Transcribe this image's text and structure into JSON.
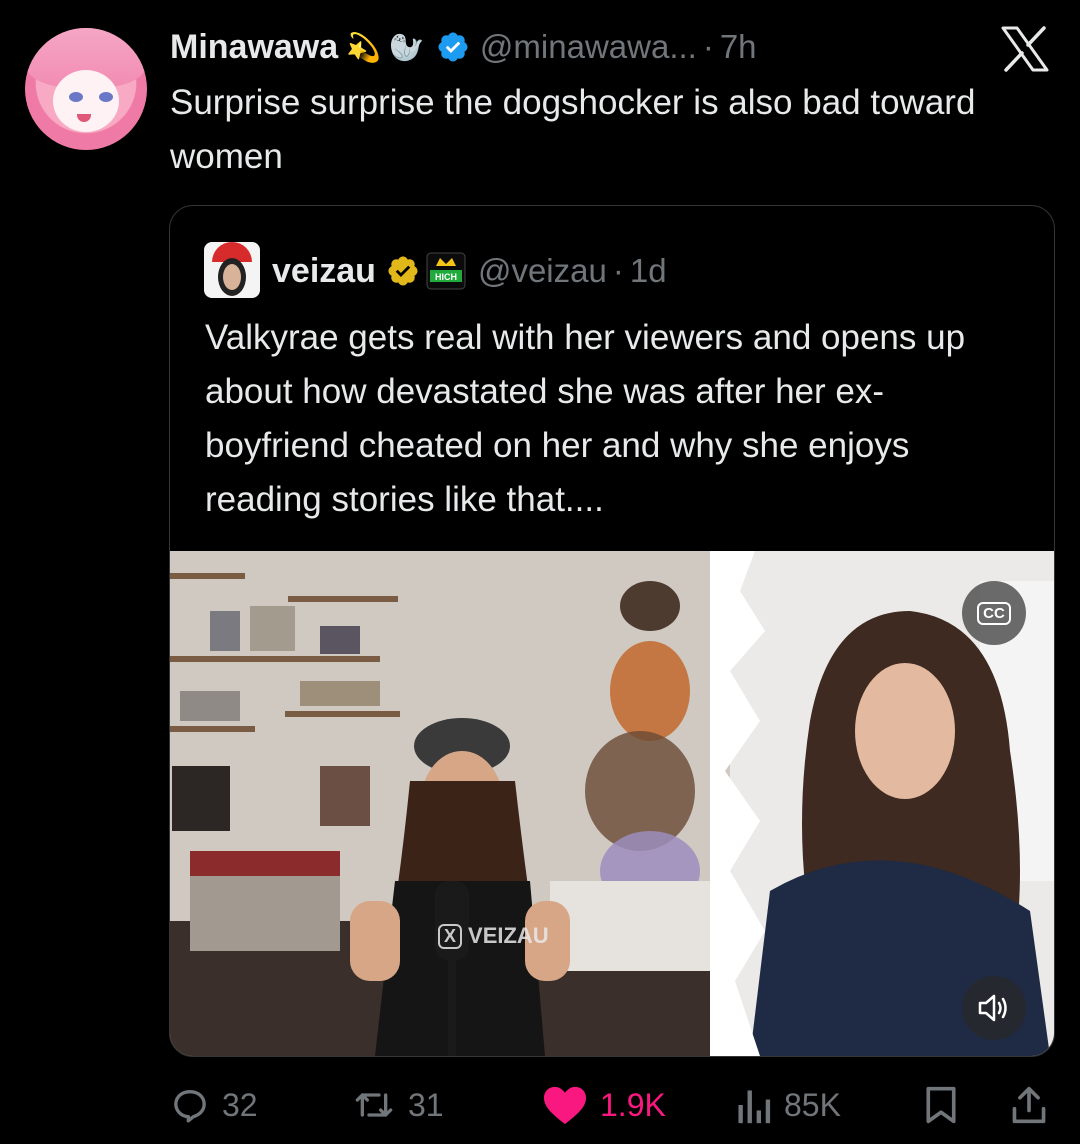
{
  "tweet": {
    "author_name": "Minawawa",
    "author_handle": "@minawawa...",
    "time": "7h",
    "separator": "·",
    "text": "Surprise surprise the dogshocker is also bad toward women",
    "name_emojis": [
      "dizzy-star",
      "seal"
    ]
  },
  "quoted": {
    "author_name": "veizau",
    "author_handle": "@veizau",
    "time": "1d",
    "separator": "·",
    "text": "Valkyrae gets real with her viewers and opens up about how devastated she was after her ex-boyfriend cheated on her and why she enjoys reading stories like that....",
    "badge_text": "HICH",
    "media": {
      "watermark": "VEIZAU",
      "cc_label": "CC"
    }
  },
  "actions": {
    "replies": "32",
    "reposts": "31",
    "likes": "1.9K",
    "views": "85K"
  },
  "colors": {
    "background": "#000000",
    "text": "#e7e9ea",
    "muted": "#71767b",
    "verified_blue": "#1d9bf0",
    "verified_gold": "#e2b719",
    "like_pink": "#f91880",
    "border": "#333639"
  }
}
